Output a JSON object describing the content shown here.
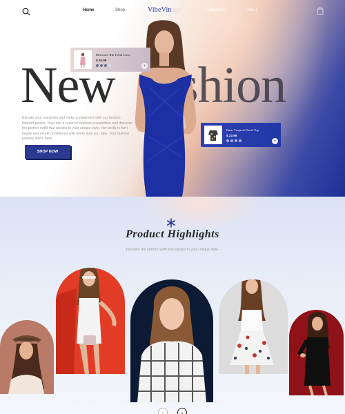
{
  "nav": {
    "links": [
      "Home",
      "Shop",
      "Categories",
      "About"
    ],
    "logo_main": "VibeVin",
    "logo_tail": "age",
    "icons": {
      "search": "search-icon",
      "bag": "shopping-bag-icon"
    }
  },
  "hero": {
    "title_left": "New",
    "title_right": "shion",
    "description": "Elevate your wardrobe and make a statement with our fashion-forward pieces. Step into a realm of endless possibilities and discover the perfect outfit that speaks to your unique style. Her bodly to turn heads and exude confidence with every step you take. Your fashion journey starts here!",
    "button": "SHOP NOW",
    "accent_color": "#2b3991"
  },
  "cards": [
    {
      "name": "Bluewave Rib Trend Cross",
      "price": "$ 20.99",
      "plus": "+"
    },
    {
      "name": "Basic Tropical Floral Top",
      "price": "$ 23.99",
      "plus": "+"
    }
  ],
  "highlights": {
    "title": "Product Highlights",
    "subtitle": "Discover the perfect outfit that speaks to your unique style.",
    "pager": {
      "prev": "‹",
      "next": "›"
    },
    "arch_colors": [
      "#b97a67",
      "#e33c26",
      "#0d1a33",
      "#dcdcdc",
      "#8e1218"
    ]
  }
}
